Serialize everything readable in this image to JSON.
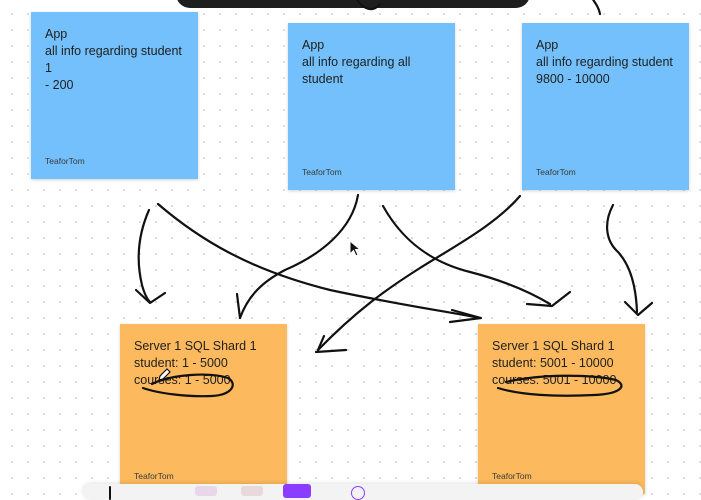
{
  "board": {
    "notes": [
      {
        "id": "app-1",
        "lines": [
          "App",
          "all info regarding student 1",
          "- 200"
        ],
        "author": "TeaforTom",
        "color": "#73c0fc"
      },
      {
        "id": "app-2",
        "lines": [
          "App",
          "all info regarding all",
          "student"
        ],
        "author": "TeaforTom",
        "color": "#73c0fc"
      },
      {
        "id": "app-3",
        "lines": [
          "App",
          "all info regarding student",
          "9800 - 10000"
        ],
        "author": "TeaforTom",
        "color": "#73c0fc"
      },
      {
        "id": "shard-1",
        "lines": [
          "Server 1 SQL Shard 1",
          "student: 1 - 5000",
          "courses: 1 - 5000"
        ],
        "author": "TeaforTom",
        "color": "#fcb95d"
      },
      {
        "id": "shard-2",
        "lines": [
          "Server 1 SQL Shard 1",
          "student: 5001 - 10000",
          "courses: 5001 - 10000"
        ],
        "author": "TeaforTom",
        "color": "#fcb95d"
      }
    ]
  },
  "icons": {
    "cursor": "cursor-arrow-icon",
    "pen": "pen-icon"
  },
  "colors": {
    "ink": "#111111",
    "toolbar_accent": "#8b3dff"
  }
}
